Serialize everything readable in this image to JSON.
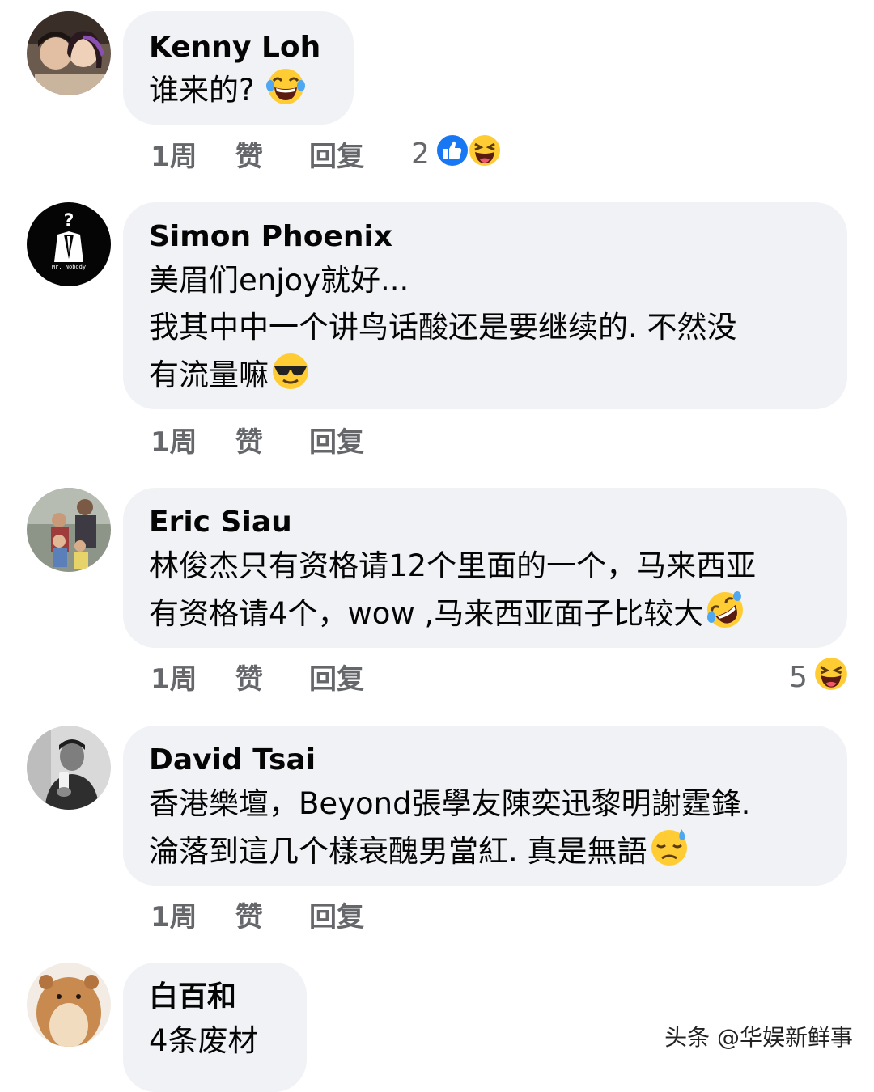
{
  "comments": [
    {
      "author": "Kenny Loh",
      "lines": [
        "谁来的?"
      ],
      "time": "1周",
      "like": "赞",
      "reply": "回复",
      "reaction_count": "2",
      "reaction_icons": [
        "like-icon",
        "laugh-emoji-icon"
      ],
      "line_emoji": "tears-of-joy-emoji"
    },
    {
      "author": "Simon Phoenix",
      "lines": [
        "美眉们enjoy就好...",
        "我其中中一个讲鸟话酸还是要继续的. 不然没",
        "有流量嘛"
      ],
      "time": "1周",
      "like": "赞",
      "reply": "回复",
      "line_emoji": "sunglasses-emoji"
    },
    {
      "author": "Eric Siau",
      "lines": [
        "林俊杰只有资格请12个里面的一个，马来西亚",
        "有资格请4个，wow ,马来西亚面子比较大"
      ],
      "time": "1周",
      "like": "赞",
      "reply": "回复",
      "reaction_count": "5",
      "reaction_icons": [
        "laugh-emoji-icon"
      ],
      "line_emoji": "rolling-laugh-emoji"
    },
    {
      "author": "David Tsai",
      "lines": [
        "香港樂壇，Beyond張學友陳奕迅黎明謝霆鋒.",
        "淪落到這几个樣衰醜男當紅. 真是無語"
      ],
      "time": "1周",
      "like": "赞",
      "reply": "回复",
      "line_emoji": "sweat-emoji"
    },
    {
      "author": "白百和",
      "lines": [
        "4条废材"
      ]
    }
  ],
  "watermark": "头条 @华娱新鲜事",
  "colors": {
    "bubble": "#f0f2f5",
    "meta_text": "#65676b",
    "like_blue": "#1877f2",
    "emoji_yellow": "#ffcc33"
  }
}
